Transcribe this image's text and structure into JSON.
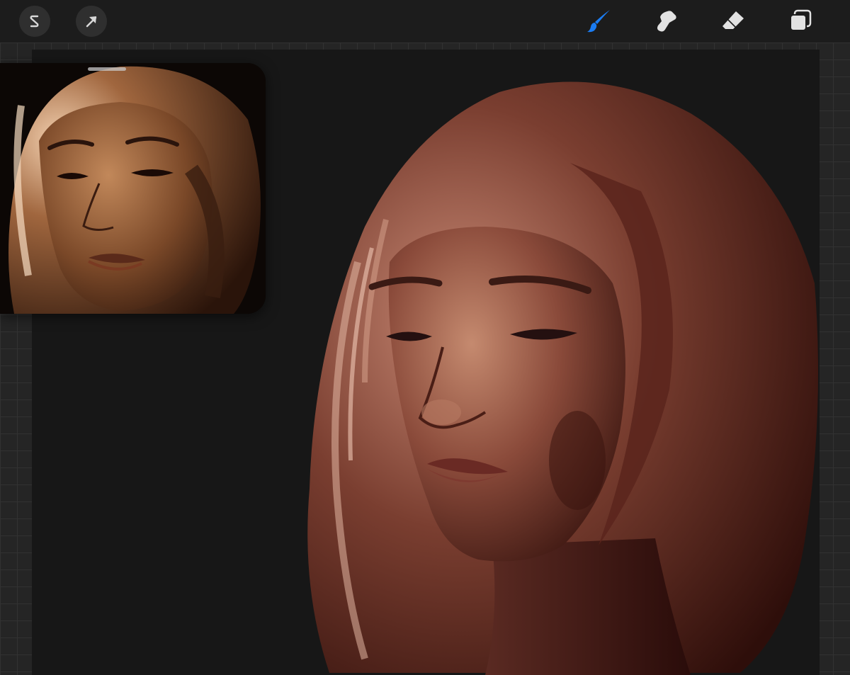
{
  "toolbar": {
    "left_tools": [
      {
        "name": "settings",
        "icon": "wrench-s-icon"
      },
      {
        "name": "selection",
        "icon": "arrow-cursor-icon"
      }
    ],
    "right_tools": [
      {
        "name": "brush",
        "icon": "brush-icon",
        "active": true
      },
      {
        "name": "smudge",
        "icon": "smudge-icon",
        "active": false
      },
      {
        "name": "eraser",
        "icon": "eraser-icon",
        "active": false
      },
      {
        "name": "layers",
        "icon": "layers-icon",
        "active": false
      }
    ],
    "active_color": "#1b7cf2"
  },
  "canvas": {
    "background_color": "#171717",
    "subject": "painted-portrait"
  },
  "reference_window": {
    "content": "reference-photo"
  }
}
